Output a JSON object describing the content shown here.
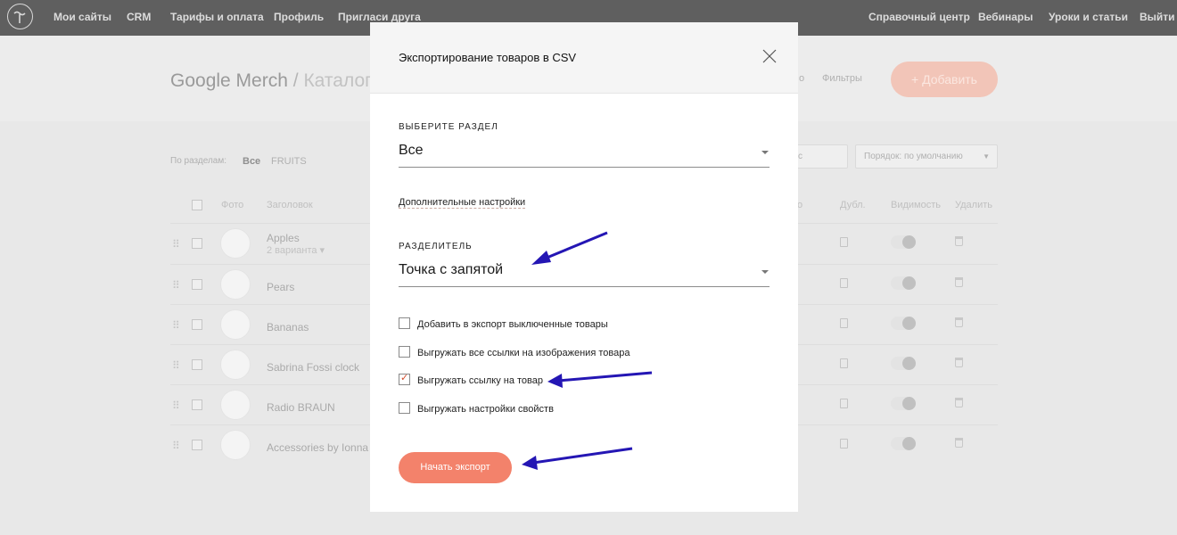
{
  "colors": {
    "nav_bg": "#5f5f5f",
    "accent": "#f3826b",
    "check_mark": "#d24c2c",
    "annotation_arrow": "#2416b4"
  },
  "topnav": {
    "left_items": [
      "Мои сайты",
      "CRM",
      "Тарифы и оплата",
      "Профиль",
      "Пригласи друга"
    ],
    "right_items": [
      "Справочный центр",
      "Вебинары",
      "Уроки и статьи",
      "Выйти"
    ]
  },
  "background": {
    "breadcrumb": {
      "project": "Google Merch",
      "separator": "/",
      "page": "Каталог"
    },
    "header_links": [
      "о",
      "Фильтры"
    ],
    "add_button": "Добавить",
    "filter_label": "По разделам:",
    "filters": [
      "Все",
      "FRUITS"
    ],
    "search_partial": "с",
    "sort_select": "Порядок: по умолчанию",
    "columns": [
      "Фото",
      "Заголовок",
      "о",
      "Дубл.",
      "Видимость",
      "Удалить"
    ],
    "products": [
      {
        "title": "Apples",
        "subtitle": "2 варианта ▾"
      },
      {
        "title": "Pears",
        "subtitle": ""
      },
      {
        "title": "Bananas",
        "subtitle": ""
      },
      {
        "title": "Sabrina Fossi clock",
        "subtitle": ""
      },
      {
        "title": "Radio BRAUN",
        "subtitle": ""
      },
      {
        "title": "Accessories by Ionna",
        "subtitle": ""
      }
    ]
  },
  "modal": {
    "title": "Экспортирование товаров в CSV",
    "section_label": "ВЫБЕРИТЕ РАЗДЕЛ",
    "section_value": "Все",
    "extra_settings_link": "Дополнительные настройки",
    "separator_label": "РАЗДЕЛИТЕЛЬ",
    "separator_value": "Точка с запятой",
    "checkboxes": [
      {
        "label": "Добавить в экспорт выключенные товары",
        "checked": false
      },
      {
        "label": "Выгружать все ссылки на изображения товара",
        "checked": false
      },
      {
        "label": "Выгружать ссылку на товар",
        "checked": true
      },
      {
        "label": "Выгружать настройки свойств",
        "checked": false
      }
    ],
    "export_button": "Начать экспорт"
  }
}
